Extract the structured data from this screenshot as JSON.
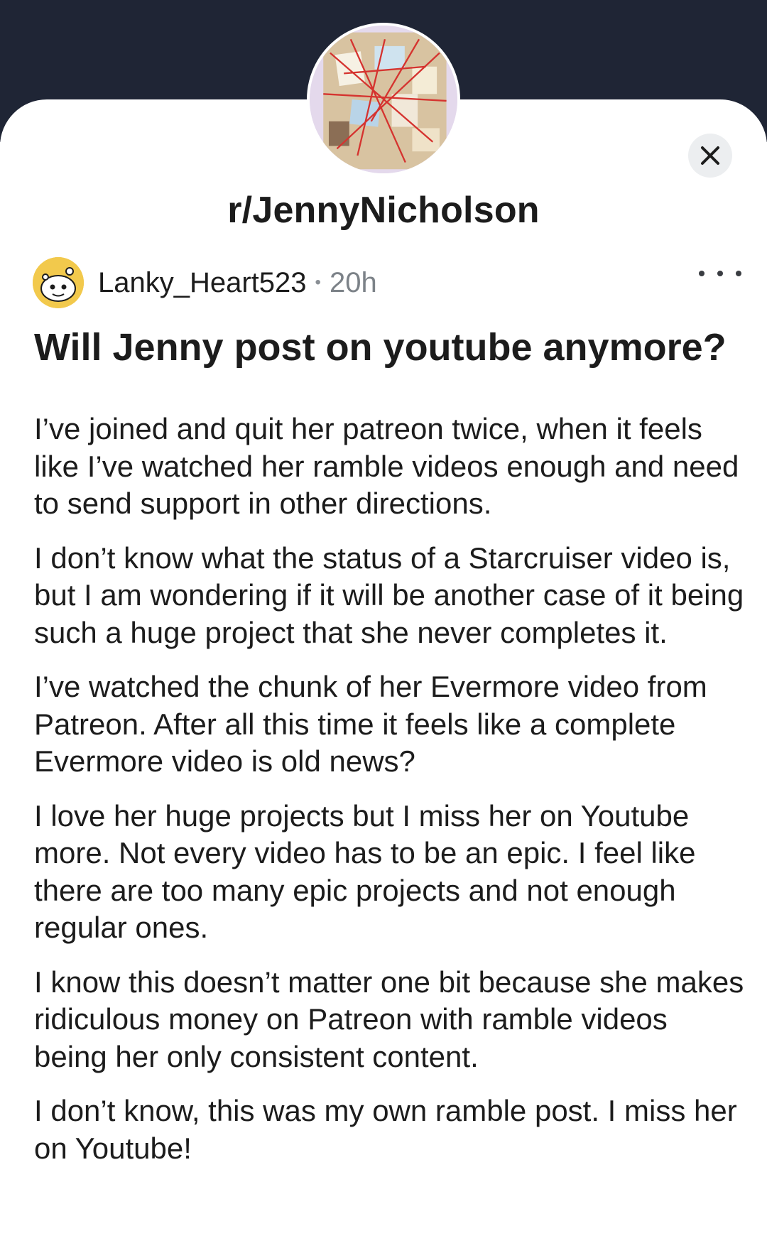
{
  "subreddit": {
    "name": "r/JennyNicholson"
  },
  "post": {
    "author": "Lanky_Heart523",
    "separator": "•",
    "time": "20h",
    "title": "Will Jenny post on youtube anymore?",
    "paragraphs": [
      "I’ve joined and quit her patreon twice, when it feels like I’ve watched her ramble videos enough and need to send support in other directions.",
      "I don’t know what the status of a Starcruiser video is, but I am wondering if it will be another case of it being such a huge project that she never completes it.",
      "I’ve watched the chunk of her Evermore video from Patreon. After all this time it feels like a complete Evermore video is old news?",
      "I love her huge projects but I miss her on Youtube more. Not every video has to be an epic. I feel like there are too many epic projects and not enough regular ones.",
      "I know this doesn’t matter one bit because she makes ridiculous money on Patreon with ramble videos being her only consistent content.",
      "I don’t know, this was my own ramble post. I miss her on Youtube!"
    ]
  },
  "icons": {
    "close": "close-icon",
    "more": "more-options-icon",
    "subreddit_avatar": "subreddit-avatar",
    "user_avatar": "user-avatar"
  },
  "colors": {
    "header_bg": "#1f2535",
    "sheet_bg": "#ffffff",
    "text": "#1c1c1c",
    "meta": "#7c8288",
    "user_avatar_bg": "#f2c94c"
  }
}
